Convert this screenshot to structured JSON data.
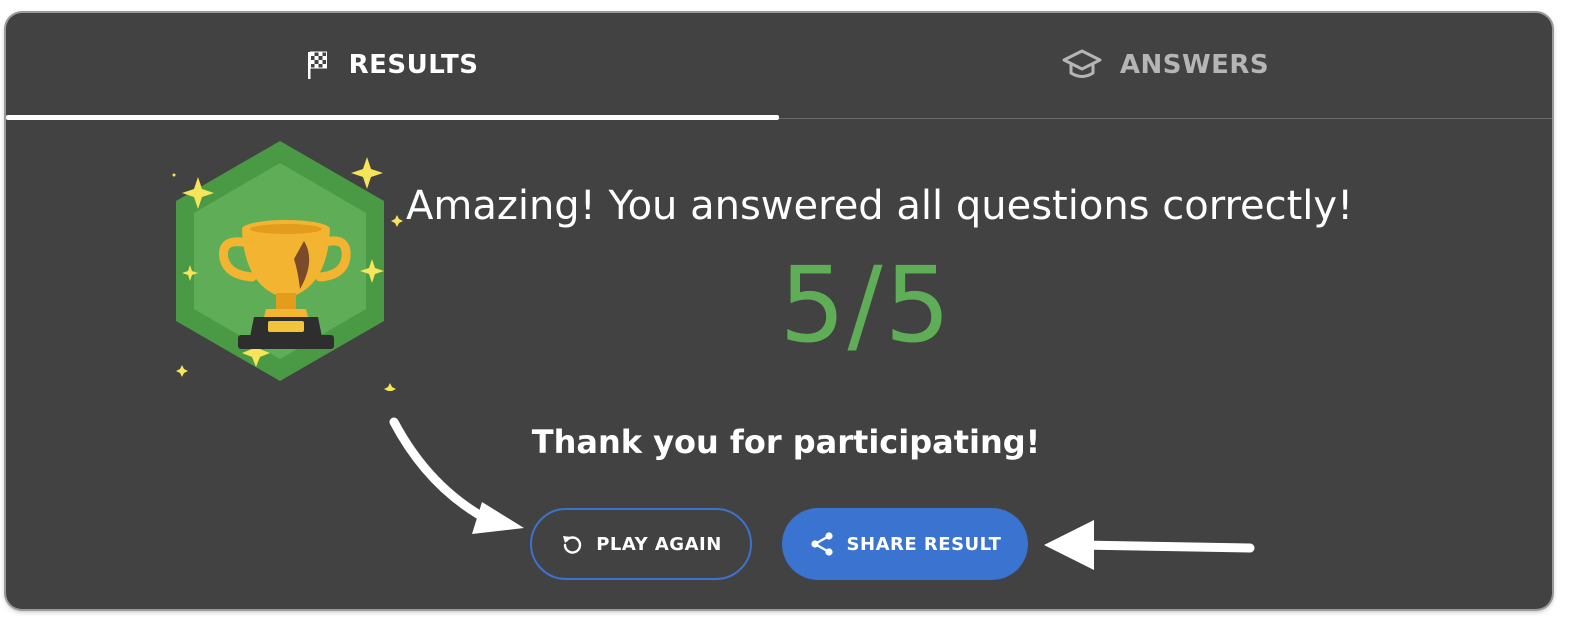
{
  "tabs": {
    "results": {
      "label": "RESULTS",
      "icon": "checkered-flag-icon"
    },
    "answers": {
      "label": "ANSWERS",
      "icon": "graduation-cap-icon"
    }
  },
  "result": {
    "headline": "Amazing! You answered all questions correctly!",
    "score": "5/5",
    "thanks": "Thank you for participating!",
    "badge_icon": "trophy-icon"
  },
  "buttons": {
    "play_again": {
      "label": "PLAY AGAIN",
      "icon": "replay-icon"
    },
    "share_result": {
      "label": "SHARE RESULT",
      "icon": "share-icon"
    }
  },
  "colors": {
    "card_bg": "#424242",
    "score_green": "#5fad56",
    "accent_blue": "#3a74d0"
  }
}
